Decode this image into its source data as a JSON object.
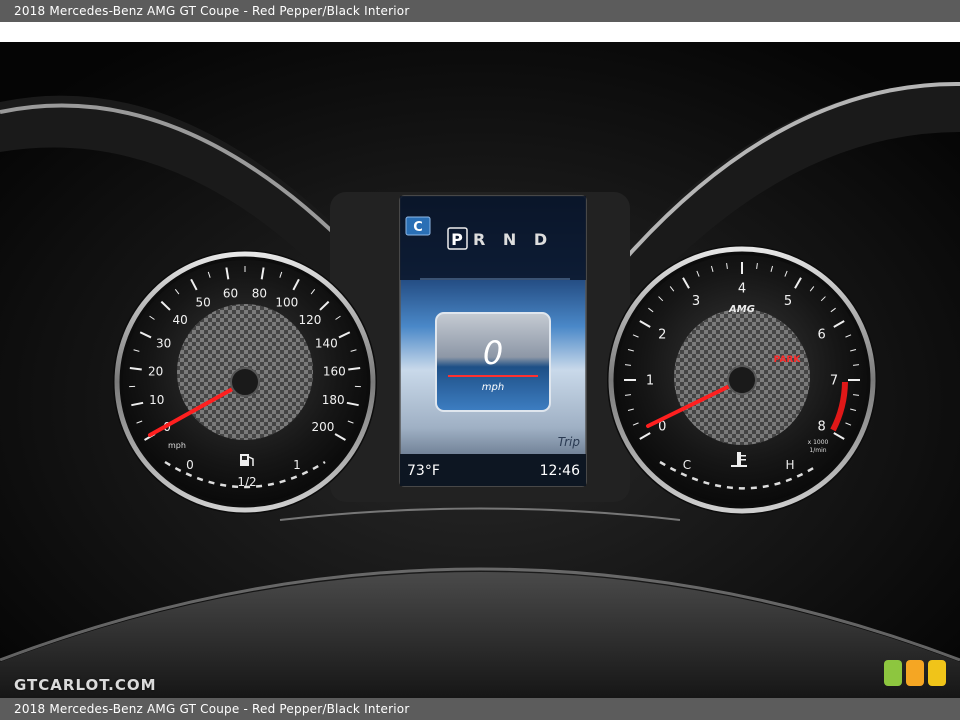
{
  "caption": "2018 Mercedes-Benz AMG GT Coupe - Red Pepper/Black Interior",
  "watermark": "GTCARLOT.COM",
  "display": {
    "mode_badge": "C",
    "gear_park": "P",
    "gear_others": "R N D",
    "speed_value": "0",
    "speed_unit": "mph",
    "trip_label": "Trip",
    "temperature": "73°F",
    "clock": "12:46"
  },
  "speedometer": {
    "ticks": [
      "0",
      "10",
      "20",
      "30",
      "40",
      "50",
      "60",
      "80",
      "100",
      "120",
      "140",
      "160",
      "180",
      "200"
    ],
    "unit": "mph",
    "fuel_empty": "0",
    "fuel_half": "1/2",
    "fuel_full": "1"
  },
  "tachometer": {
    "ticks": [
      "0",
      "1",
      "2",
      "3",
      "4",
      "5",
      "6",
      "7",
      "8"
    ],
    "brand": "AMG",
    "park_label": "PARK",
    "unit_line1": "x 1000",
    "unit_line2": "1/min",
    "temp_cold": "C",
    "temp_hot": "H"
  },
  "colors": {
    "needle": "#ff1f1f",
    "screen_blue": "#2a6fb5",
    "dot_green": "#8dc63f",
    "dot_orange": "#f5a623",
    "dot_yellow": "#f0c419"
  }
}
